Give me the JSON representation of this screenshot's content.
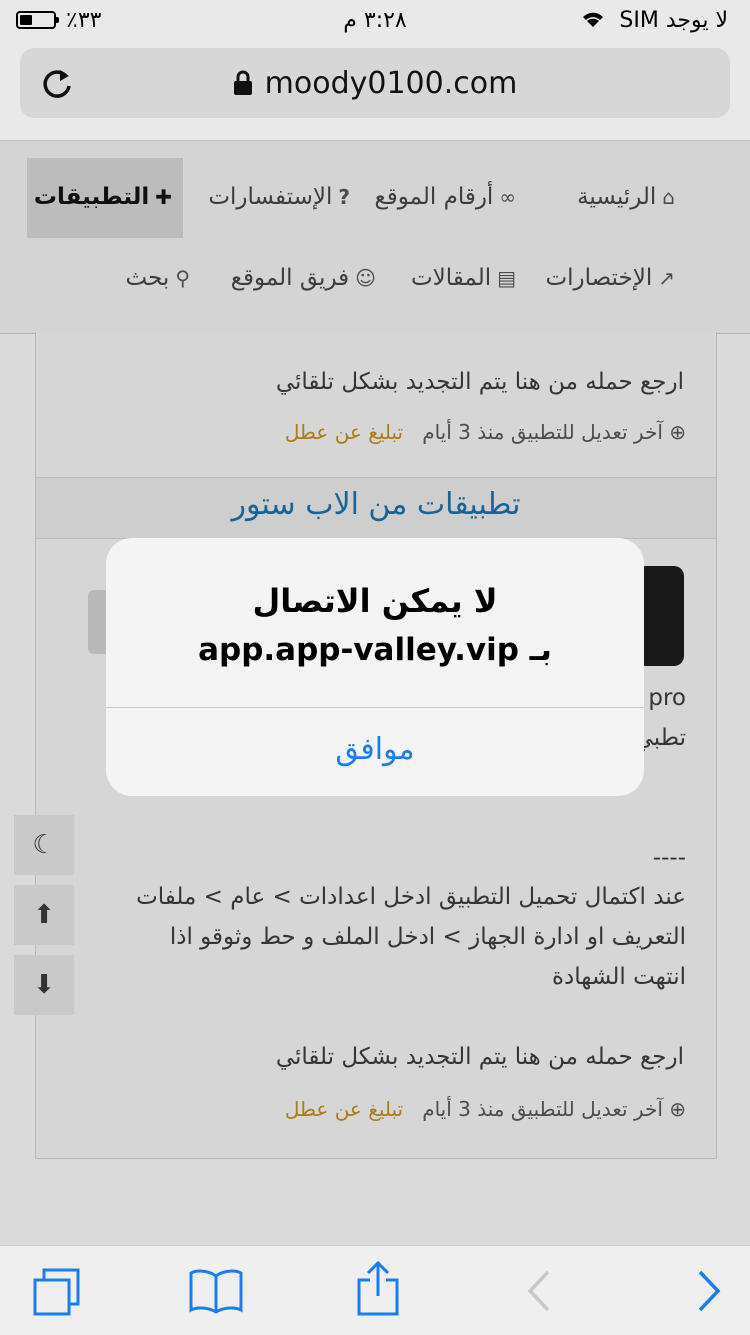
{
  "status_bar": {
    "carrier": "لا يوجد SIM",
    "time": "٣:٢٨ م",
    "battery": "٪٣٣"
  },
  "browser": {
    "url": "moody0100.com"
  },
  "nav": {
    "items": [
      {
        "label": "الرئيسية",
        "icon": "home-icon"
      },
      {
        "label": "أرقام الموقع",
        "icon": "link-icon"
      },
      {
        "label": "الإستفسارات",
        "icon": "question-icon"
      },
      {
        "label": "التطبيقات",
        "icon": "puzzle-icon",
        "active": true
      },
      {
        "label": "الإختصارات",
        "icon": "share-icon"
      },
      {
        "label": "المقالات",
        "icon": "document-icon"
      },
      {
        "label": "فريق الموقع",
        "icon": "user-icon"
      },
      {
        "label": "بحث",
        "icon": "search-icon"
      }
    ]
  },
  "content": {
    "top_note": "ارجع حمله من هنا يتم التجديد بشكل تلقائي",
    "top_meta": "آخر تعديل للتطبيق منذ 3 أيام",
    "top_report": "تبليغ عن عطل",
    "section_title": "تطبيقات من الاب ستور",
    "partial_pro": "pro",
    "partial_app": "تطبي",
    "dashes": "----",
    "instructions": [
      "عند اكتمال تحميل التطبيق ادخل اعدادات > عام > ملفات",
      "التعريف او ادارة الجهاز > ادخل الملف و حط وثوقو اذا",
      "انتهت الشهادة"
    ],
    "bottom_note": "ارجع حمله من هنا يتم التجديد بشكل تلقائي",
    "bottom_meta": "آخر تعديل للتطبيق منذ 3 أيام",
    "bottom_report": "تبليغ عن عطل"
  },
  "alert": {
    "title_line1": "لا يمكن الاتصال",
    "title_line2": "بـ app.app-valley.vip",
    "ok_label": "موافق"
  },
  "colors": {
    "link_blue": "#1e7cf2",
    "report_orange": "#c08a1e",
    "section_blue": "#1f6fa8"
  }
}
